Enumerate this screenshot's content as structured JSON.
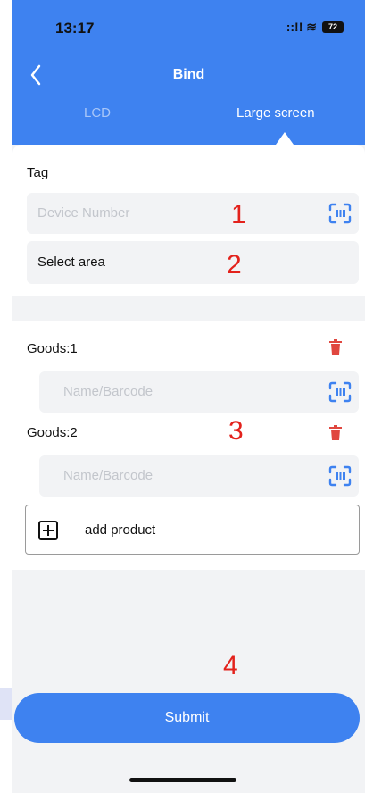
{
  "status_bar": {
    "time": "13:17",
    "signal": "::!! ≋",
    "battery": "72"
  },
  "header": {
    "title": "Bind"
  },
  "tabs": [
    {
      "label": "LCD",
      "active": false
    },
    {
      "label": "Large screen",
      "active": true
    }
  ],
  "tag_section": {
    "label": "Tag",
    "device_placeholder": "Device Number",
    "select_area": "Select area"
  },
  "goods": [
    {
      "label": "Goods:1",
      "placeholder": "Name/Barcode"
    },
    {
      "label": "Goods:2",
      "placeholder": "Name/Barcode"
    }
  ],
  "add_product_label": "add product",
  "submit_label": "Submit",
  "annotations": [
    "1",
    "2",
    "3",
    "4"
  ],
  "colors": {
    "accent": "#3e82f0",
    "delete": "#e0473f",
    "annotation": "#e3221c"
  }
}
